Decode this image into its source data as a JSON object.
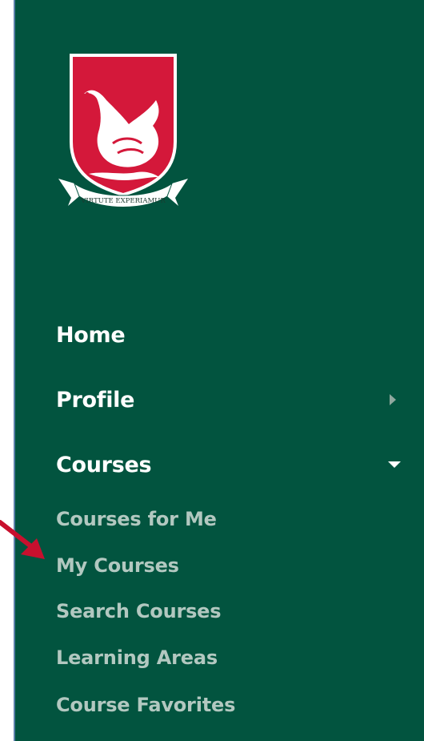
{
  "crest": {
    "motto": "VIRTUTE EXPERIAMUR"
  },
  "nav": {
    "home": "Home",
    "profile": "Profile",
    "courses": "Courses",
    "courses_sub": [
      "Courses for Me",
      "My Courses",
      "Search Courses",
      "Learning Areas",
      "Course Favorites"
    ]
  },
  "icons": {
    "profile_chevron": "chevron-right-icon",
    "courses_chevron": "chevron-down-icon"
  },
  "colors": {
    "sidebar_bg": "#02543f",
    "crest_red": "#d4183a",
    "nav_text": "#ffffff",
    "subnav_text": "#b2c8c0",
    "annotation_arrow": "#c8102e"
  }
}
